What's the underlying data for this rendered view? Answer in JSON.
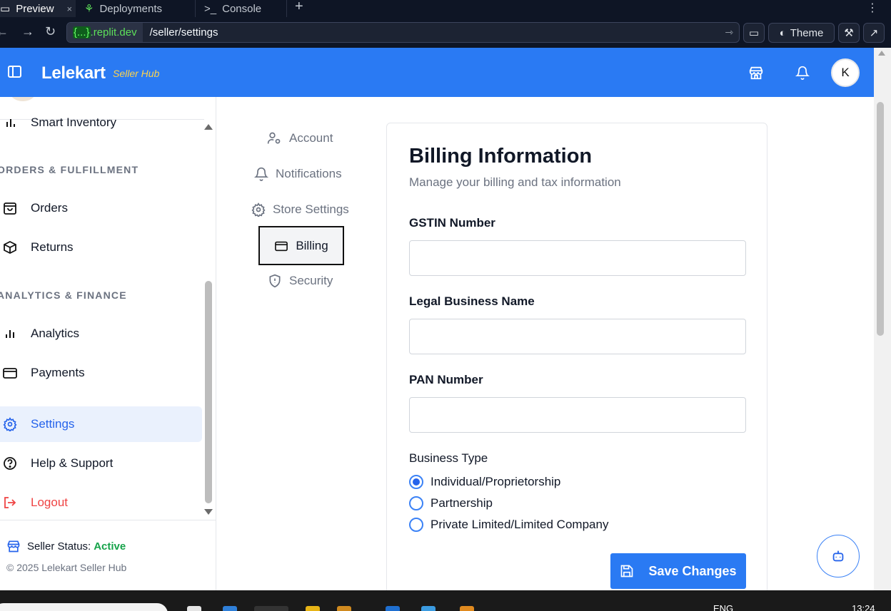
{
  "browser": {
    "tabs": [
      {
        "label": "Preview",
        "close": "×"
      },
      {
        "label": "Deployments"
      },
      {
        "label": "Console"
      }
    ],
    "new_tab": "+",
    "domain_badge": "{...}",
    "domain": ".replit.dev",
    "path": "/seller/settings",
    "theme_label": "Theme"
  },
  "header": {
    "brand": "Lelekart",
    "brand_sub": "Seller Hub",
    "avatar_initial": "K",
    "color": "#2a7af3"
  },
  "sidebar": {
    "items_top": [
      {
        "label": "Smart Inventory"
      }
    ],
    "sections": [
      {
        "title": "ORDERS & FULFILLMENT",
        "items": [
          {
            "label": "Orders"
          },
          {
            "label": "Returns"
          }
        ]
      },
      {
        "title": "ANALYTICS & FINANCE",
        "items": [
          {
            "label": "Analytics"
          },
          {
            "label": "Payments"
          }
        ]
      }
    ],
    "bottom_items": [
      {
        "label": "Settings",
        "active": true
      },
      {
        "label": "Help & Support"
      },
      {
        "label": "Logout"
      }
    ],
    "status_label": "Seller Status:",
    "status_value": "Active",
    "copyright": "© 2025 Lelekart Seller Hub"
  },
  "settings_nav": [
    {
      "label": "Account",
      "icon": "user-gear-icon"
    },
    {
      "label": "Notifications",
      "icon": "bell-icon"
    },
    {
      "label": "Store Settings",
      "icon": "gear-icon"
    },
    {
      "label": "Billing",
      "icon": "credit-card-icon",
      "selected": true
    },
    {
      "label": "Security",
      "icon": "shield-icon"
    }
  ],
  "card": {
    "title": "Billing Information",
    "description": "Manage your billing and tax information",
    "fields": [
      {
        "label": "GSTIN Number",
        "value": ""
      },
      {
        "label": "Legal Business Name",
        "value": ""
      },
      {
        "label": "PAN Number",
        "value": ""
      }
    ],
    "business_type": {
      "label": "Business Type",
      "options": [
        "Individual/Proprietorship",
        "Partnership",
        "Private Limited/Limited Company"
      ],
      "selected": "Individual/Proprietorship"
    },
    "save_label": "Save Changes"
  },
  "taskbar": {
    "lang": "ENG",
    "time": "13:24"
  }
}
